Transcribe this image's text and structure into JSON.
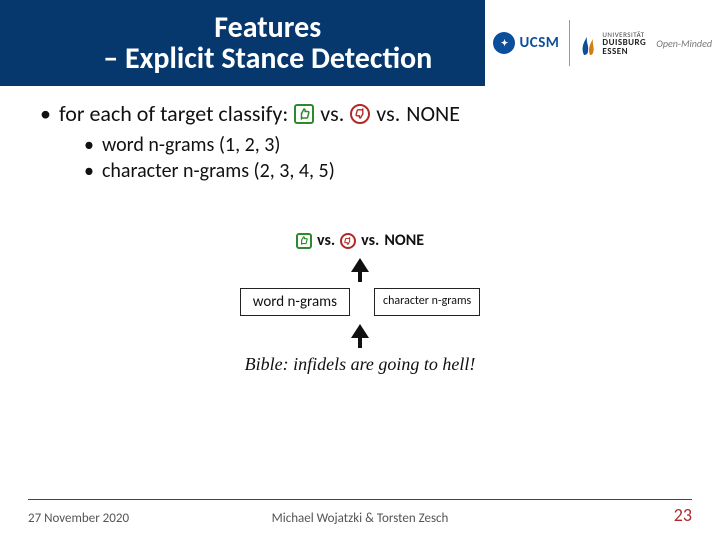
{
  "header": {
    "title_line1": "Features",
    "title_line2_prefix": "– ",
    "title_line2": "Explicit Stance Detection",
    "ucsm": "UCSM",
    "uni_top": "UNIVERSITÄT",
    "uni_main1": "DUISBURG",
    "uni_main2": "ESSEN",
    "uni_motto": "Open-Minded"
  },
  "content": {
    "main_bullet_pre": "for each of target classify:",
    "vs": "vs.",
    "none": "NONE",
    "sub1": "word n-grams (1, 2, 3)",
    "sub2": "character n-grams (2, 3, 4, 5)"
  },
  "diagram": {
    "feat1": "word n-grams",
    "feat2": "character n-grams",
    "example": "Bible: infidels are going to hell!"
  },
  "footer": {
    "date": "27 November 2020",
    "center": "Michael Wojatzki & Torsten Zesch",
    "page": "23"
  },
  "icons": {
    "thumbs_up": "thumbs-up-icon",
    "thumbs_down": "thumbs-down-icon"
  }
}
